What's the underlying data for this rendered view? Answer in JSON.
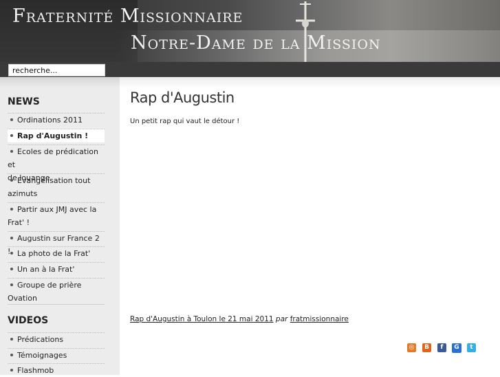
{
  "header": {
    "title_line1": "Fraternité Missionnaire",
    "title_line2": "Notre-Dame de la Mission",
    "search_value": "recherche..."
  },
  "sidebar": {
    "news_heading": "NEWS",
    "news_items": [
      {
        "label": "Ordinations 2011"
      },
      {
        "label": "Rap d'Augustin !"
      },
      {
        "label_line1": "Ecoles de prédication et",
        "label_line2": "de louange"
      },
      {
        "label_line1": "Evangélisation tout",
        "label_line2": "azimuts"
      },
      {
        "label_line1": "Partir aux JMJ avec la",
        "label_line2": "Frat' !"
      },
      {
        "label": "Augustin sur France 2 !"
      },
      {
        "label": "La photo de la Frat'"
      },
      {
        "label": "Un an à la Frat'"
      },
      {
        "label": "Groupe de prière Ovation"
      }
    ],
    "videos_heading": "VIDEOS",
    "video_items": [
      {
        "label": "Prédications"
      },
      {
        "label": "Témoignages"
      },
      {
        "label": "Flashmob"
      }
    ]
  },
  "main": {
    "title": "Rap d'Augustin",
    "intro": "Un petit rap qui vaut le détour !",
    "caption_link": "Rap d'Augustin à Toulon le 21 mai 2011",
    "caption_par": "par",
    "caption_author": "fratmissionnaire"
  },
  "share_icons": [
    {
      "name": "share-icon",
      "color": "#e07b2a",
      "glyph": "◎"
    },
    {
      "name": "blogger-icon",
      "color": "#e0641a",
      "glyph": "B"
    },
    {
      "name": "facebook-icon",
      "color": "#3b5998",
      "glyph": "f"
    },
    {
      "name": "google-icon",
      "color": "#2a6fd8",
      "glyph": "G"
    },
    {
      "name": "twitter-icon",
      "color": "#35aee8",
      "glyph": "t"
    }
  ]
}
